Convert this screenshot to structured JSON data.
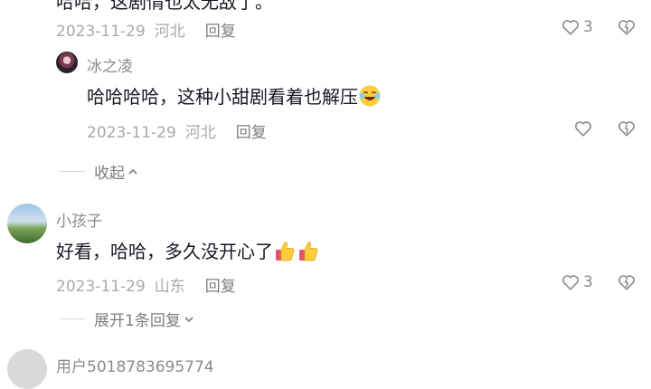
{
  "top_comment": {
    "text_partial": "哈哈，这剧情也太无敌了。",
    "date": "2023-11-29",
    "location": "河北",
    "reply_label": "回复",
    "likes": "3"
  },
  "reply1": {
    "user": "冰之凌",
    "text": "哈哈哈哈，这种小甜剧看着也解压",
    "date": "2023-11-29",
    "location": "河北",
    "reply_label": "回复"
  },
  "collapse_label": "收起",
  "comment2": {
    "user": "小孩子",
    "text": "好看，哈哈，多久没开心了",
    "date": "2023-11-29",
    "location": "山东",
    "reply_label": "回复",
    "likes": "3",
    "expand_label": "展开1条回复"
  },
  "comment3": {
    "user": "用户5018783695774"
  },
  "icons": {
    "heart": "heart-icon",
    "dislike": "dislike-heart-icon",
    "laugh": "laughing-emoji",
    "thumbs": "thumbs-up-emoji",
    "chevron_up": "chevron-up-icon",
    "chevron_down": "chevron-down-icon"
  },
  "colors": {
    "text": "#161823",
    "meta": "#a9a9ad",
    "secondary": "#7d7d82"
  }
}
